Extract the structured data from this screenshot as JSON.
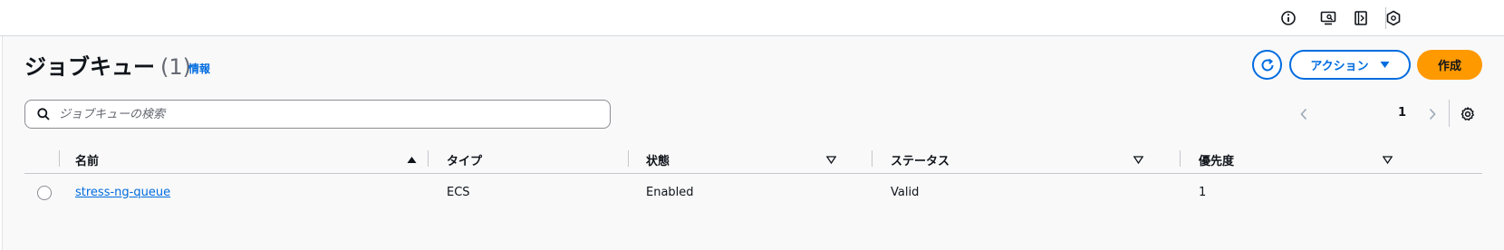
{
  "topbar": {
    "icons": [
      "info-icon",
      "screen-search-icon",
      "notebook-icon",
      "hexagon-settings-icon"
    ]
  },
  "header": {
    "title": "ジョブキュー",
    "count": "(1)",
    "info_link": "情報",
    "actions_label": "アクション",
    "create_label": "作成"
  },
  "search": {
    "placeholder": "ジョブキューの検索",
    "value": ""
  },
  "pagination": {
    "current_page": "1"
  },
  "table": {
    "columns": [
      {
        "key": "name",
        "label": "名前",
        "sort": "ascending"
      },
      {
        "key": "type",
        "label": "タイプ",
        "sort": "none"
      },
      {
        "key": "state",
        "label": "状態",
        "sort": "filter"
      },
      {
        "key": "status",
        "label": "ステータス",
        "sort": "filter"
      },
      {
        "key": "priority",
        "label": "優先度",
        "sort": "filter"
      }
    ],
    "rows": [
      {
        "name": "stress-ng-queue",
        "type": "ECS",
        "state": "Enabled",
        "status": "Valid",
        "priority": "1"
      }
    ]
  },
  "colors": {
    "accent": "#006ce0",
    "primary_button": "#ff9900",
    "panel_bg": "#f9f9f9",
    "text": "#0f141a"
  }
}
